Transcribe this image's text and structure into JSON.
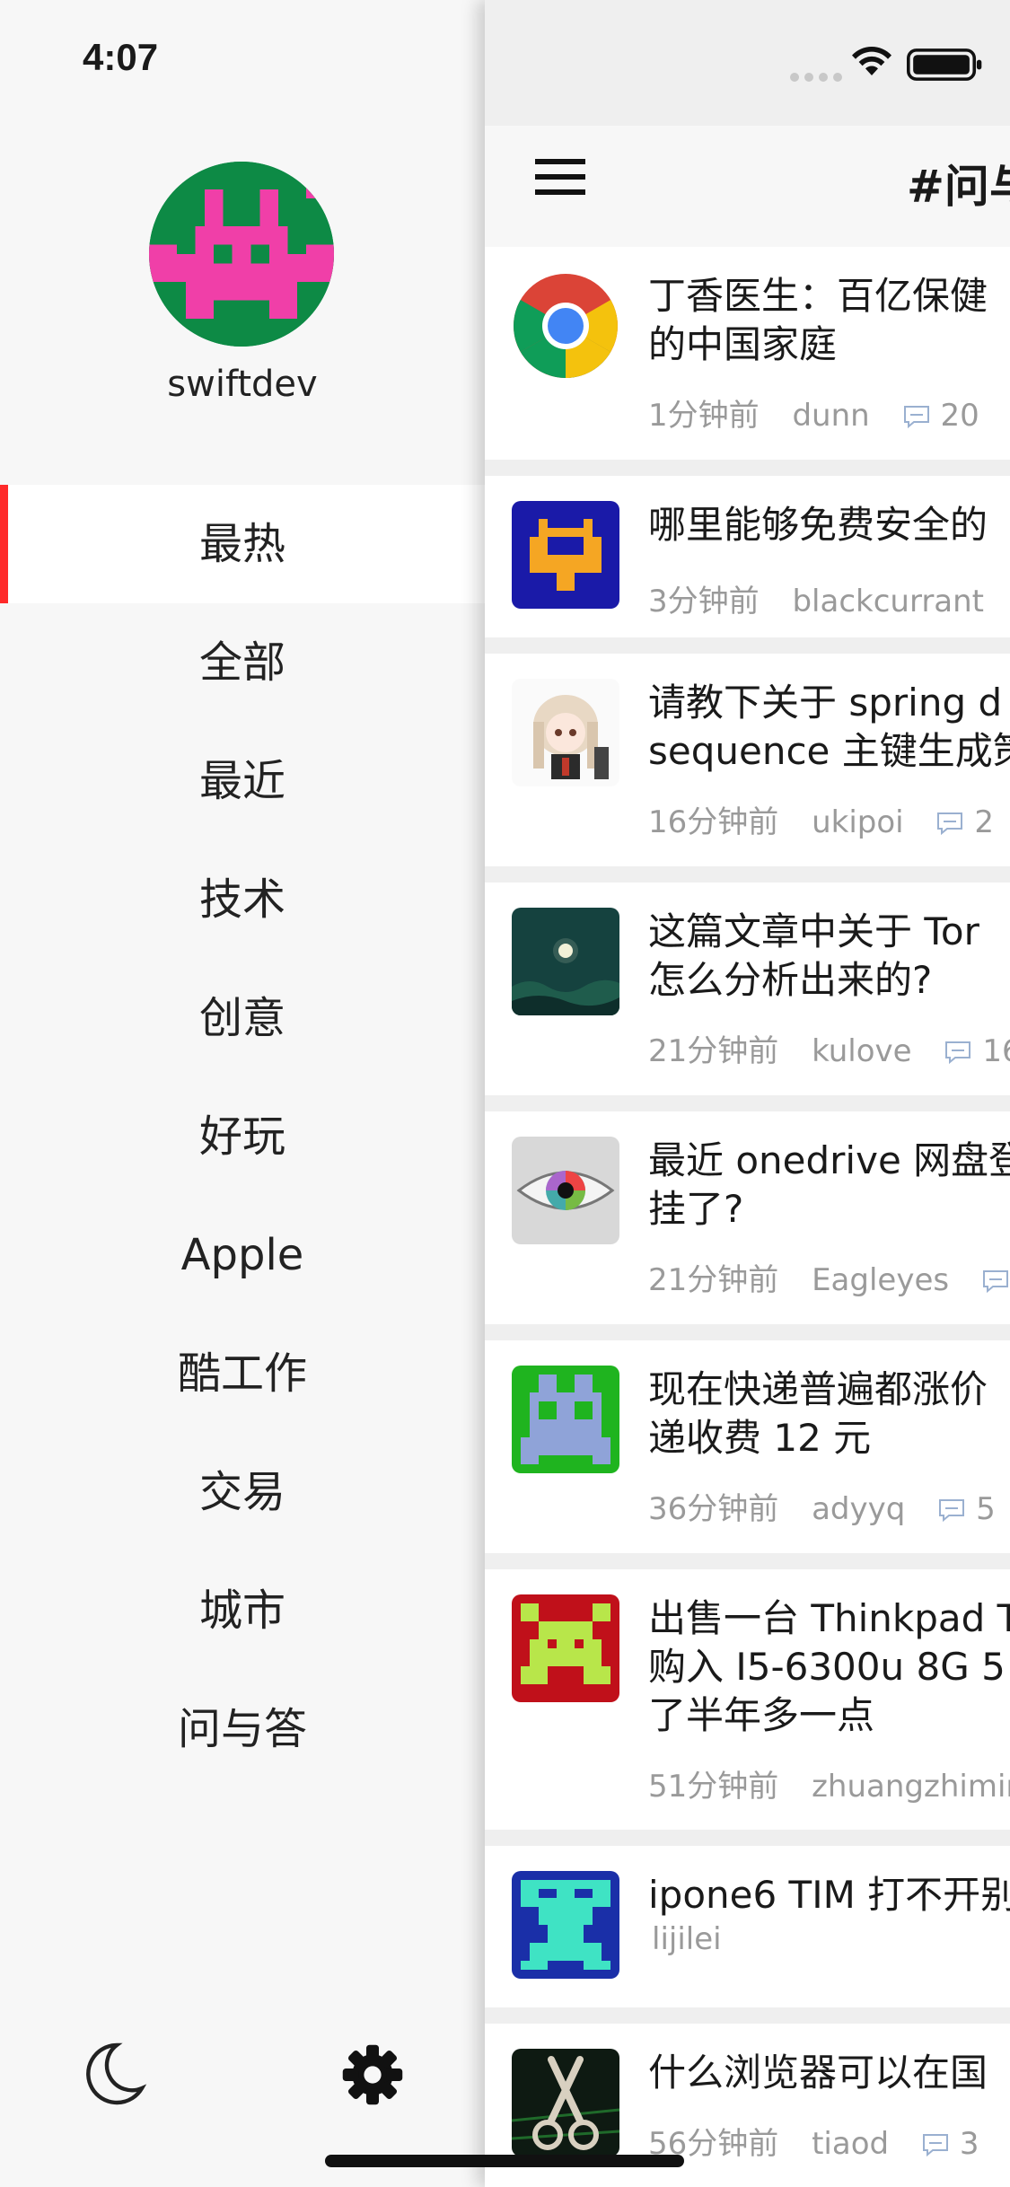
{
  "status": {
    "time": "4:07"
  },
  "drawer": {
    "username": "swiftdev",
    "menu": [
      {
        "label": "最热",
        "active": true
      },
      {
        "label": "全部"
      },
      {
        "label": "最近"
      },
      {
        "label": "技术"
      },
      {
        "label": "创意"
      },
      {
        "label": "好玩"
      },
      {
        "label": "Apple"
      },
      {
        "label": "酷工作"
      },
      {
        "label": "交易"
      },
      {
        "label": "城市"
      },
      {
        "label": "问与答"
      }
    ],
    "bottom_icons": [
      "moon-icon",
      "gear-icon"
    ]
  },
  "main": {
    "title": "#问与",
    "topics": [
      {
        "title": "丁香医生：百亿保健\n的中国家庭",
        "time": "1分钟前",
        "author": "dunn",
        "replies": "20",
        "thumb": "chrome-logo"
      },
      {
        "title": "哪里能够免费安全的",
        "time": "3分钟前",
        "author": "blackcurrant",
        "replies": "",
        "thumb": "pixel-avatar-orange"
      },
      {
        "title": "请教下关于 spring d\nsequence 主键生成策",
        "time": "16分钟前",
        "author": "ukipoi",
        "replies": "2",
        "thumb": "anime-avatar"
      },
      {
        "title": "这篇文章中关于 Tor\n怎么分析出来的?",
        "time": "21分钟前",
        "author": "kulove",
        "replies": "16",
        "thumb": "moon-landscape"
      },
      {
        "title": "最近 onedrive 网盘登\n挂了?",
        "time": "21分钟前",
        "author": "Eagleyes",
        "replies": "",
        "thumb": "eye-photo"
      },
      {
        "title": "现在快递普遍都涨价\n递收费 12 元",
        "time": "36分钟前",
        "author": "adyyq",
        "replies": "5",
        "thumb": "pixel-avatar-blue"
      },
      {
        "title": "出售一台 Thinkpad T\n购入 I5-6300u 8G 5\n了半年多一点",
        "time": "51分钟前",
        "author": "zhuangzhimin",
        "replies": "",
        "thumb": "pixel-avatar-red"
      },
      {
        "title": "ipone6 TIM 打不开别",
        "time": "",
        "author": "lijilei",
        "replies": "",
        "thumb": "pixel-avatar-cyan"
      },
      {
        "title": "什么浏览器可以在国",
        "time": "56分钟前",
        "author": "tiaod",
        "replies": "3",
        "thumb": "scissors-photo"
      }
    ]
  }
}
